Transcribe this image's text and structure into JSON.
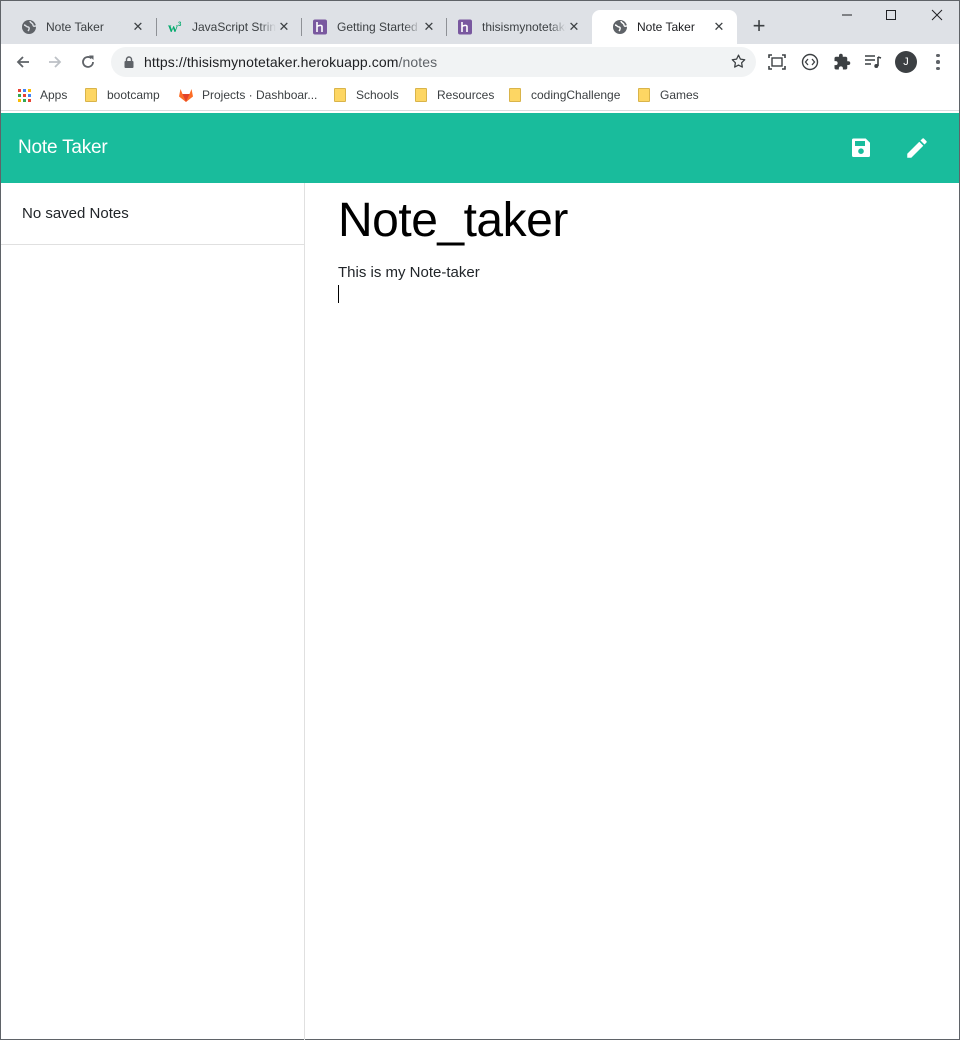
{
  "browser": {
    "tabs": [
      {
        "title": "Note Taker",
        "icon": "globe-icon",
        "active": false
      },
      {
        "title": "JavaScript String",
        "icon": "w3schools-icon",
        "active": false
      },
      {
        "title": "Getting Started",
        "icon": "heroku-icon",
        "active": false
      },
      {
        "title": "thisismynotetaker",
        "icon": "heroku-icon",
        "active": false
      },
      {
        "title": "Note Taker",
        "icon": "globe-icon",
        "active": true
      }
    ],
    "new_tab_label": "+",
    "url": {
      "host": "https://thisismynotetaker.herokuapp.com",
      "path": "/notes"
    },
    "avatar_letter": "J",
    "bookmarks": [
      {
        "label": "Apps",
        "icon": "apps-grid-icon"
      },
      {
        "label": "bootcamp",
        "icon": "folder-icon"
      },
      {
        "label": "Projects · Dashboar...",
        "icon": "gitlab-icon"
      },
      {
        "label": "Schools",
        "icon": "folder-icon"
      },
      {
        "label": "Resources",
        "icon": "folder-icon"
      },
      {
        "label": "codingChallenge",
        "icon": "folder-icon"
      },
      {
        "label": "Games",
        "icon": "folder-icon"
      }
    ]
  },
  "app": {
    "brand": "Note Taker",
    "accent_color": "#19bc9c",
    "sidebar": {
      "empty_message": "No saved Notes"
    },
    "editor": {
      "title": "Note_taker",
      "body": "This is my Note-taker"
    }
  }
}
